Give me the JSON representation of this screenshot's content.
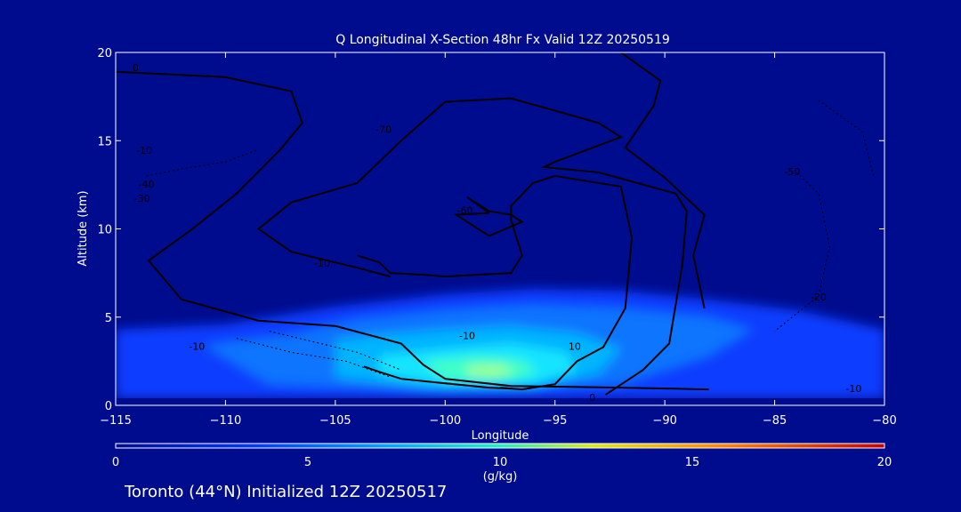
{
  "chart_data": {
    "type": "heatmap",
    "title": "Q Longitudinal X-Section 48hr  Fx Valid 12Z 20250519",
    "xlabel": "Longitude",
    "ylabel": "Altitude (km)",
    "xlim": [
      -115,
      -80
    ],
    "ylim": [
      0,
      20
    ],
    "xticks": [
      -115,
      -110,
      -105,
      -100,
      -95,
      -90,
      -85,
      -80
    ],
    "yticks": [
      0,
      5,
      10,
      15,
      20
    ],
    "shading_variable": "specific humidity",
    "colorbar": {
      "label": "(g/kg)",
      "range": [
        0,
        20
      ],
      "ticks": [
        0,
        5,
        10,
        15,
        20
      ]
    },
    "moisture_regions": [
      {
        "level": 1,
        "points": [
          [
            -115,
            4.3
          ],
          [
            -110,
            4.6
          ],
          [
            -105,
            5.6
          ],
          [
            -100,
            6.3
          ],
          [
            -96,
            6.6
          ],
          [
            -92,
            6.5
          ],
          [
            -88,
            6.0
          ],
          [
            -84,
            5.4
          ],
          [
            -80,
            4.3
          ],
          [
            -80,
            0.4
          ],
          [
            -115,
            0.4
          ]
        ]
      },
      {
        "level": 2,
        "points": [
          [
            -111,
            3.4
          ],
          [
            -107,
            4.0
          ],
          [
            -104,
            4.9
          ],
          [
            -100,
            5.4
          ],
          [
            -96,
            5.7
          ],
          [
            -92,
            5.5
          ],
          [
            -88,
            5.0
          ],
          [
            -86,
            4.3
          ],
          [
            -88,
            2.8
          ],
          [
            -92,
            1.2
          ],
          [
            -100,
            0.8
          ],
          [
            -108,
            1.2
          ]
        ]
      },
      {
        "level": 3,
        "points": [
          [
            -105,
            3.7
          ],
          [
            -103,
            4.0
          ],
          [
            -100,
            4.3
          ],
          [
            -97,
            4.5
          ],
          [
            -94,
            4.1
          ],
          [
            -92,
            3.2
          ],
          [
            -93,
            1.8
          ],
          [
            -96,
            1.0
          ],
          [
            -101,
            1.0
          ],
          [
            -105,
            1.6
          ]
        ]
      },
      {
        "level": 4,
        "points": [
          [
            -103,
            2.8
          ],
          [
            -100,
            3.2
          ],
          [
            -97,
            3.5
          ],
          [
            -94.5,
            3.0
          ],
          [
            -94,
            2.0
          ],
          [
            -96,
            1.2
          ],
          [
            -100,
            1.2
          ],
          [
            -103,
            1.8
          ]
        ]
      },
      {
        "level": 5,
        "points": [
          [
            -101,
            2.5
          ],
          [
            -98.5,
            2.8
          ],
          [
            -96.5,
            2.6
          ],
          [
            -95.8,
            1.9
          ],
          [
            -97,
            1.4
          ],
          [
            -100,
            1.4
          ]
        ]
      },
      {
        "level": 6,
        "points": [
          [
            -99,
            2.2
          ],
          [
            -97.5,
            2.3
          ],
          [
            -96.8,
            1.9
          ],
          [
            -97.8,
            1.6
          ],
          [
            -99,
            1.7
          ]
        ]
      }
    ],
    "contour_labels": [
      {
        "text": "-70",
        "x": -102.8,
        "y": 15.6
      },
      {
        "text": "-60",
        "x": -99.1,
        "y": 11.0
      },
      {
        "text": "-50",
        "x": -84.2,
        "y": 13.2
      },
      {
        "text": "-40",
        "x": -113.6,
        "y": 12.5
      },
      {
        "text": "-30",
        "x": -113.8,
        "y": 11.7
      },
      {
        "text": "-20",
        "x": -83.0,
        "y": 6.1
      },
      {
        "text": "-10",
        "x": -105.6,
        "y": 8.0
      },
      {
        "text": "-10",
        "x": -99.0,
        "y": 3.9
      },
      {
        "text": "-10",
        "x": -111.3,
        "y": 3.3
      },
      {
        "text": "-10",
        "x": -81.4,
        "y": 0.9
      },
      {
        "text": "-10",
        "x": -113.7,
        "y": 14.4
      },
      {
        "text": "0",
        "x": -93.3,
        "y": 0.4
      },
      {
        "text": "0",
        "x": -114.1,
        "y": 19.1
      },
      {
        "text": "10",
        "x": -94.1,
        "y": 3.3
      }
    ],
    "contour_lines": [
      {
        "style": "solid",
        "points": [
          [
            -115,
            18.9
          ],
          [
            -110,
            18.6
          ],
          [
            -107,
            17.8
          ],
          [
            -106.5,
            16.0
          ],
          [
            -107.5,
            14.5
          ],
          [
            -109.5,
            12.0
          ],
          [
            -111.5,
            10.0
          ],
          [
            -113.5,
            8.2
          ],
          [
            -112,
            6.0
          ],
          [
            -108.5,
            4.8
          ],
          [
            -105,
            4.5
          ],
          [
            -102,
            3.5
          ],
          [
            -101,
            2.3
          ],
          [
            -100,
            1.5
          ],
          [
            -97,
            1.1
          ],
          [
            -92,
            1.0
          ],
          [
            -88,
            0.9
          ]
        ]
      },
      {
        "style": "solid",
        "points": [
          [
            -102.5,
            7.3
          ],
          [
            -104,
            7.8
          ],
          [
            -107,
            8.7
          ],
          [
            -108.5,
            10.0
          ],
          [
            -107,
            11.5
          ],
          [
            -104,
            12.6
          ],
          [
            -102,
            15.0
          ],
          [
            -100,
            17.2
          ],
          [
            -97,
            17.4
          ],
          [
            -93,
            16.0
          ],
          [
            -92,
            15.2
          ],
          [
            -95,
            13.8
          ],
          [
            -95.5,
            13.5
          ],
          [
            -93,
            13.2
          ],
          [
            -89.5,
            12.0
          ],
          [
            -89,
            11.0
          ],
          [
            -89.2,
            8.0
          ],
          [
            -89.8,
            3.5
          ],
          [
            -91,
            2.0
          ],
          [
            -92.7,
            0.6
          ]
        ]
      },
      {
        "style": "solid",
        "points": [
          [
            -98,
            10.9
          ],
          [
            -99,
            11.8
          ],
          [
            -98,
            11.0
          ],
          [
            -97,
            10.8
          ],
          [
            -96.5,
            10.4
          ],
          [
            -98,
            9.6
          ],
          [
            -99.5,
            10.8
          ],
          [
            -98,
            10.9
          ]
        ]
      },
      {
        "style": "solid",
        "points": [
          [
            -104,
            8.5
          ],
          [
            -103,
            8.1
          ],
          [
            -102.5,
            7.5
          ],
          [
            -101,
            7.4
          ],
          [
            -100,
            7.3
          ],
          [
            -97,
            7.5
          ],
          [
            -96.5,
            8.5
          ],
          [
            -97,
            10.5
          ],
          [
            -97,
            11.3
          ],
          [
            -96,
            12.6
          ],
          [
            -95,
            13.0
          ],
          [
            -92,
            12.4
          ],
          [
            -91.5,
            9.5
          ],
          [
            -91.8,
            5.5
          ],
          [
            -92.8,
            3.3
          ],
          [
            -94,
            2.5
          ],
          [
            -95,
            1.2
          ],
          [
            -96.5,
            0.9
          ],
          [
            -97.5,
            1.0
          ]
        ]
      },
      {
        "style": "solid",
        "points": [
          [
            -103.7,
            2.2
          ],
          [
            -103,
            1.9
          ],
          [
            -102,
            1.5
          ],
          [
            -100,
            1.25
          ],
          [
            -98,
            1.0
          ],
          [
            -97,
            0.95
          ]
        ]
      },
      {
        "style": "solid",
        "points": [
          [
            -88.2,
            5.5
          ],
          [
            -88.7,
            8.5
          ],
          [
            -88.2,
            10.8
          ],
          [
            -90,
            12.9
          ],
          [
            -91.8,
            14.6
          ],
          [
            -90.5,
            17.0
          ],
          [
            -90.2,
            18.4
          ],
          [
            -92,
            20.0
          ]
        ]
      },
      {
        "style": "dashed",
        "points": [
          [
            -113.6,
            13.0
          ],
          [
            -112,
            13.4
          ],
          [
            -110,
            13.8
          ],
          [
            -108.5,
            14.5
          ]
        ]
      },
      {
        "style": "dashed",
        "points": [
          [
            -84,
            13.2
          ],
          [
            -83,
            12.0
          ],
          [
            -82.5,
            9.0
          ],
          [
            -83,
            6.2
          ],
          [
            -84,
            5.2
          ],
          [
            -85,
            4.2
          ]
        ]
      },
      {
        "style": "dashed",
        "points": [
          [
            -83,
            17.3
          ],
          [
            -81,
            15.5
          ],
          [
            -80.5,
            13.0
          ]
        ]
      },
      {
        "style": "dashed",
        "points": [
          [
            -108,
            4.2
          ],
          [
            -106,
            3.6
          ],
          [
            -104,
            3.0
          ],
          [
            -102,
            2.0
          ]
        ]
      },
      {
        "style": "dashed",
        "points": [
          [
            -109.5,
            3.8
          ],
          [
            -107,
            3.0
          ],
          [
            -104.5,
            2.5
          ],
          [
            -102.5,
            1.6
          ]
        ]
      }
    ]
  },
  "footer": {
    "text": "Toronto (44°N) Initialized 12Z 20250517"
  }
}
